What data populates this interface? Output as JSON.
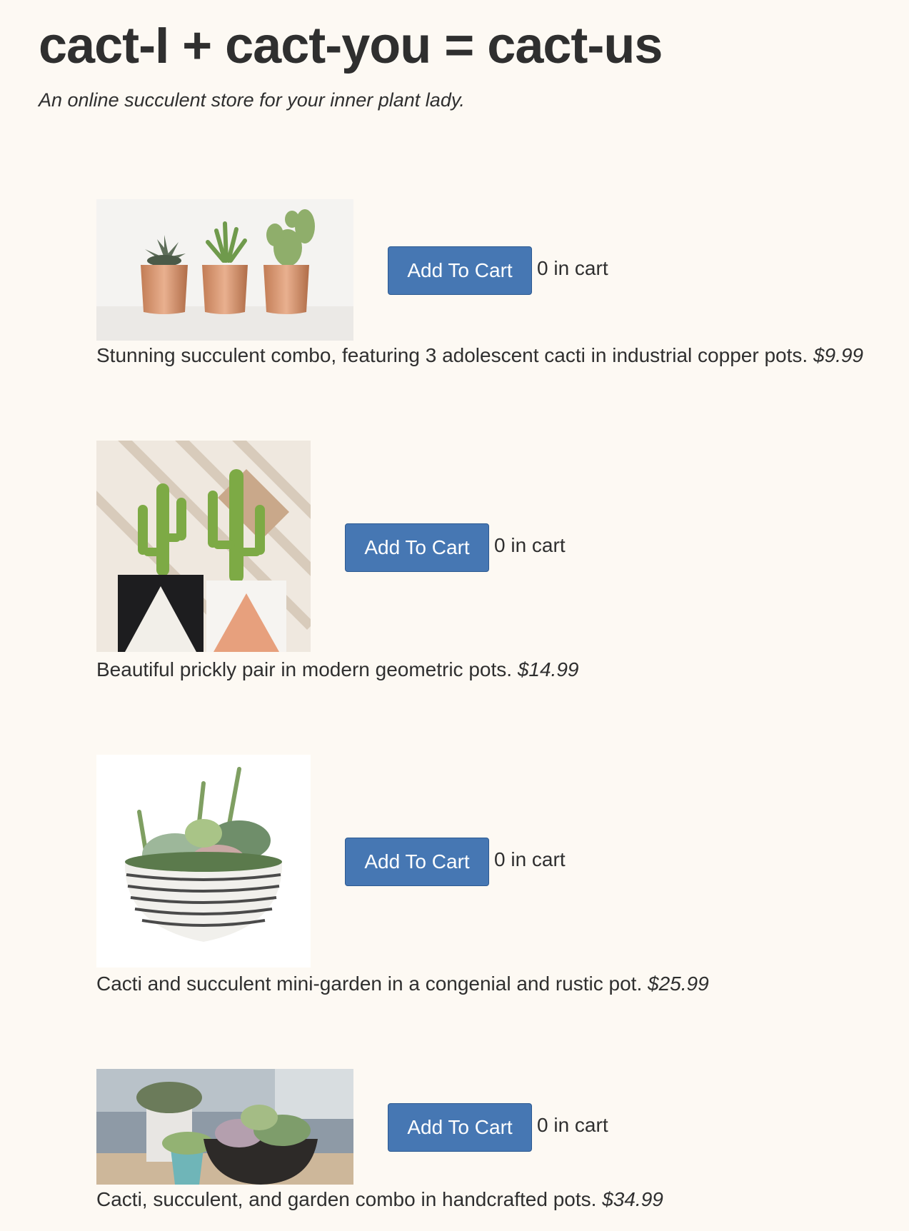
{
  "header": {
    "title": "cact-I + cact-you = cact-us",
    "tagline": "An online succulent store for your inner plant lady."
  },
  "products": [
    {
      "image_icon": "copper-pots-cacti-photo",
      "button_label": "Add To Cart",
      "cart_text": "0 in cart",
      "description": "Stunning succulent combo, featuring 3 adolescent cacti in industrial copper pots.",
      "price": "$9.99"
    },
    {
      "image_icon": "geometric-pots-cacti-photo",
      "button_label": "Add To Cart",
      "cart_text": "0 in cart",
      "description": "Beautiful prickly pair in modern geometric pots.",
      "price": "$14.99"
    },
    {
      "image_icon": "striped-bowl-succulents-photo",
      "button_label": "Add To Cart",
      "cart_text": "0 in cart",
      "description": "Cacti and succulent mini-garden in a congenial and rustic pot.",
      "price": "$25.99"
    },
    {
      "image_icon": "handcrafted-pots-succulents-photo",
      "button_label": "Add To Cart",
      "cart_text": "0 in cart",
      "description": "Cacti, succulent, and garden combo in handcrafted pots.",
      "price": "$34.99"
    }
  ],
  "colors": {
    "background": "#fdf9f3",
    "button": "#4677b3",
    "text": "#2f2f2f"
  }
}
